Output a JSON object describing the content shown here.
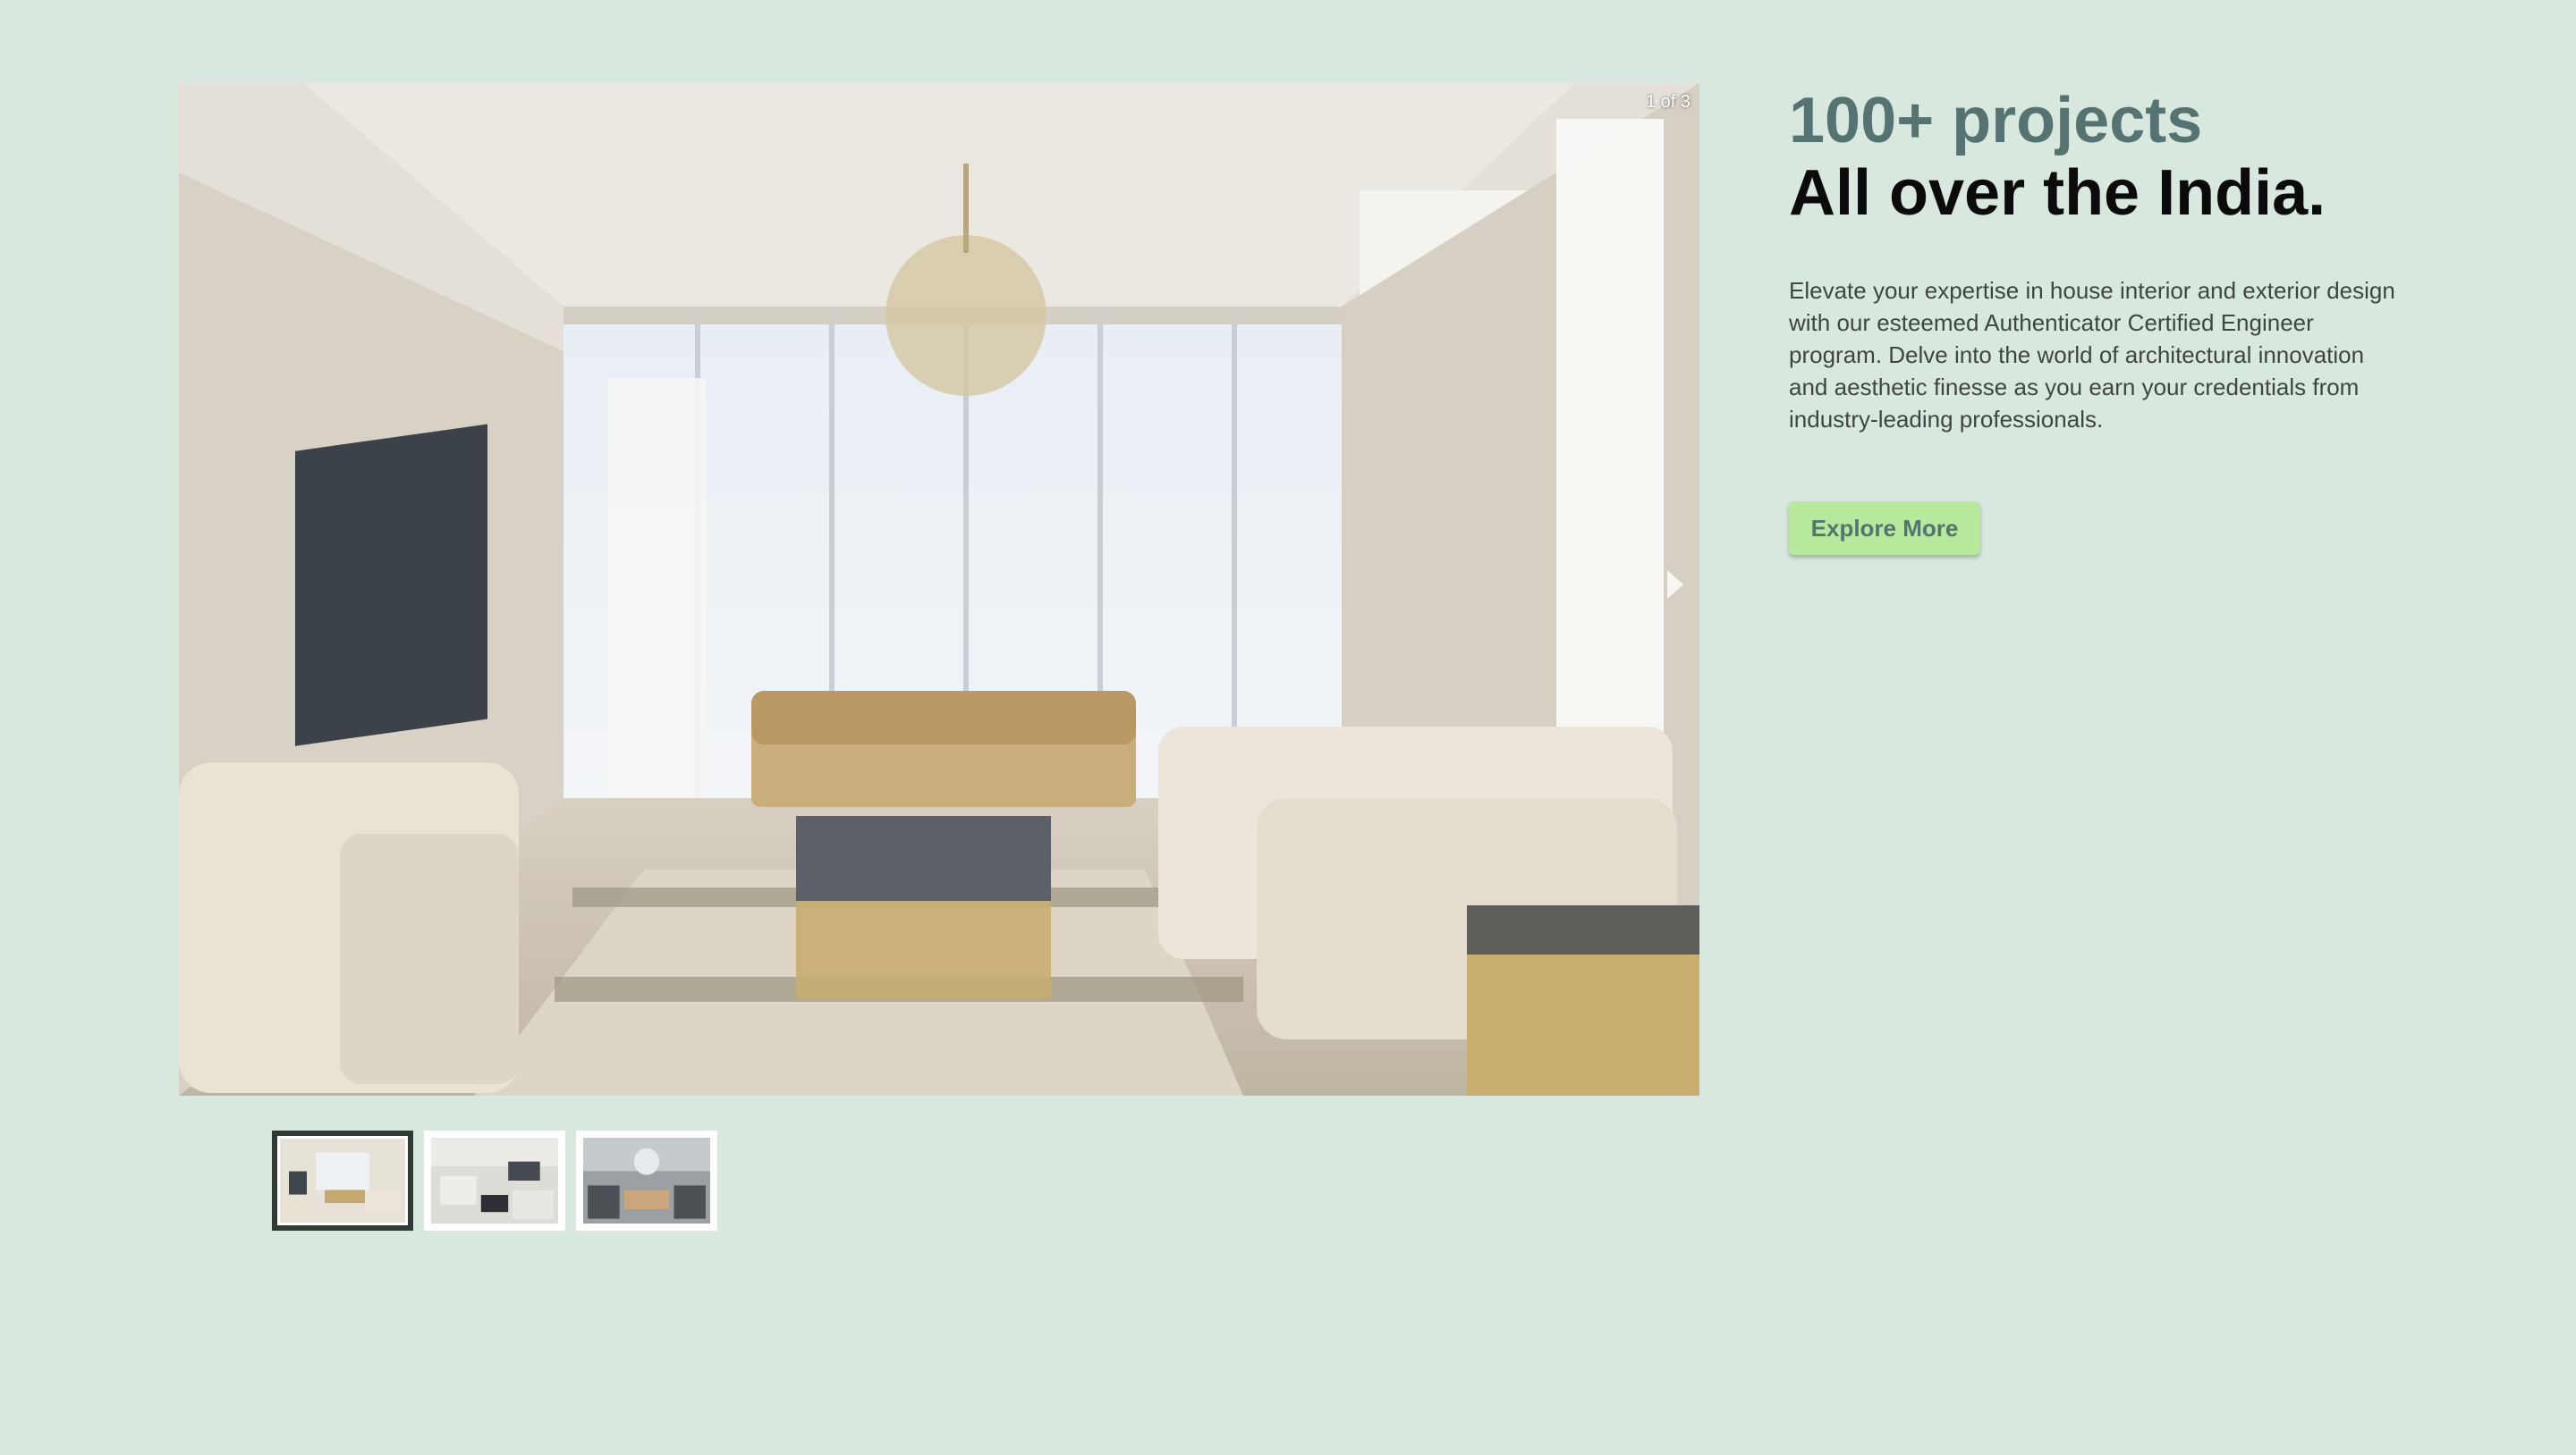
{
  "carousel": {
    "counter": "1 of 3",
    "slides": [
      "living-room-1",
      "living-room-2",
      "living-room-3"
    ],
    "active_index": 0
  },
  "hero": {
    "subtitle": "100+ projects",
    "title": "All over the India.",
    "description": "Elevate your expertise in house interior and exterior design with our esteemed Authenticator Certified Engineer program. Delve into the world of architectural innovation and aesthetic finesse as you earn your credentials from industry-leading professionals.",
    "button_label": "Explore More"
  },
  "colors": {
    "background": "#d9e8de",
    "subtitle": "#557371",
    "button": "#b6e99b",
    "thumb_active_border": "#2f3a33"
  }
}
